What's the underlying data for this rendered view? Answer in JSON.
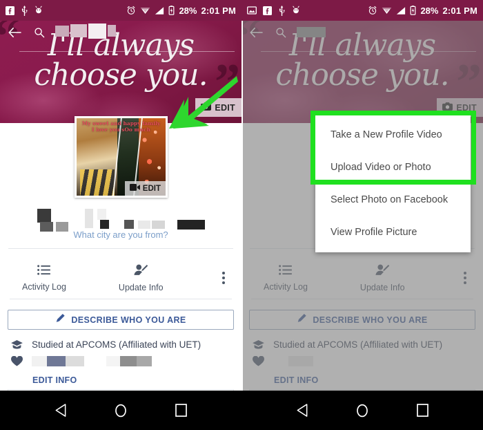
{
  "status_bar": {
    "left_icons_left_panel": [
      "facebook-icon",
      "usb-icon",
      "android-debug-icon"
    ],
    "left_icons_right_panel": [
      "screenshot-image-icon",
      "facebook-icon",
      "usb-icon",
      "android-debug-icon"
    ],
    "right_icons": [
      "alarm-icon",
      "vpn-icon",
      "signal-icon",
      "battery-charging-icon"
    ],
    "battery": "28%",
    "time": "2:01 PM"
  },
  "header": {
    "back_icon": "back-arrow-icon",
    "search_icon": "search-icon",
    "title_redacted": true
  },
  "cover": {
    "text": "I'll always\nchoose you.",
    "edit_label": "EDIT",
    "edit_icon": "camera-icon",
    "background_color": "#8e1c50"
  },
  "profile_photo": {
    "caption": "My sweet and happy family\nI love you sOo much",
    "edit_label": "EDIT",
    "edit_icon": "video-camera-icon"
  },
  "annotation": {
    "arrow_color": "#2ed62e",
    "highlight_color": "#1fe01f"
  },
  "profile": {
    "name_redacted": true,
    "city_prompt": "What city are you from?"
  },
  "actions": [
    {
      "label": "Activity Log",
      "icon": "list-icon"
    },
    {
      "label": "Update Info",
      "icon": "edit-profile-icon"
    }
  ],
  "overflow_icon": "kebab-menu-icon",
  "describe_button": {
    "label": "DESCRIBE WHO YOU ARE",
    "icon": "pencil-icon"
  },
  "info": {
    "school": {
      "icon": "graduation-cap-icon",
      "text": "Studied at APCOMS (Affiliated with UET)"
    },
    "relationship": {
      "icon": "heart-icon",
      "text_redacted": true
    },
    "edit_link": "EDIT INFO"
  },
  "popup_menu": {
    "items": [
      "Take a New Profile Video",
      "Upload Video or Photo",
      "Select Photo on Facebook",
      "View Profile Picture"
    ],
    "highlighted_count": 2
  },
  "nav_bar": {
    "buttons": [
      "back-triangle-icon",
      "home-circle-icon",
      "recents-square-icon"
    ]
  }
}
